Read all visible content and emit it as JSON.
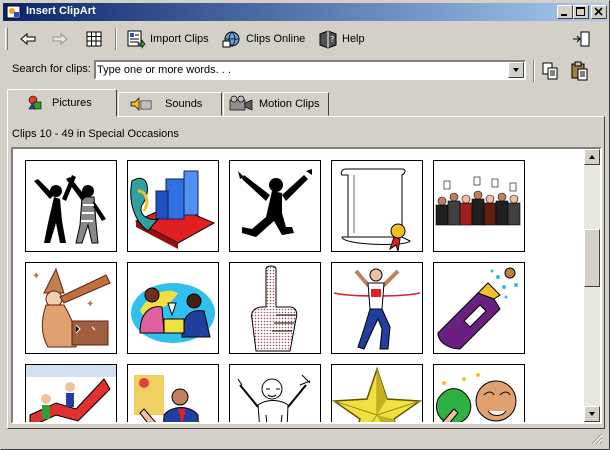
{
  "window": {
    "title": "Insert ClipArt"
  },
  "titlebar_buttons": {
    "minimize": "_",
    "maximize": "□",
    "close": "×"
  },
  "toolbar": {
    "back_icon": "back-arrow-icon",
    "forward_icon": "forward-arrow-icon",
    "all_categories_icon": "grid-icon",
    "import_label": "Import Clips",
    "online_label": "Clips Online",
    "help_label": "Help"
  },
  "search": {
    "label": "Search for clips:",
    "value": "Type one or more words. . ."
  },
  "tabs": [
    {
      "label": "Pictures",
      "icon": "pictures-icon",
      "active": true
    },
    {
      "label": "Sounds",
      "icon": "sounds-icon",
      "active": false
    },
    {
      "label": "Motion Clips",
      "icon": "motion-clips-icon",
      "active": false
    }
  ],
  "status_text": "Clips 10 - 49 in Special Occasions",
  "clips": [
    {
      "name": "dancing-figures"
    },
    {
      "name": "city-stage"
    },
    {
      "name": "jumping-figure"
    },
    {
      "name": "certificate-scroll"
    },
    {
      "name": "crowd-audience"
    },
    {
      "name": "wizard-telescope"
    },
    {
      "name": "toast-people"
    },
    {
      "name": "pointing-hand"
    },
    {
      "name": "runner-finish"
    },
    {
      "name": "champagne-bottle"
    },
    {
      "name": "growth-chart"
    },
    {
      "name": "office-figures"
    },
    {
      "name": "cheering-man"
    },
    {
      "name": "gold-star"
    },
    {
      "name": "celebrating-man"
    }
  ],
  "colors": {
    "titlebar_start": "#0a246a",
    "titlebar_end": "#a6caf0",
    "face": "#d4d0c8"
  }
}
